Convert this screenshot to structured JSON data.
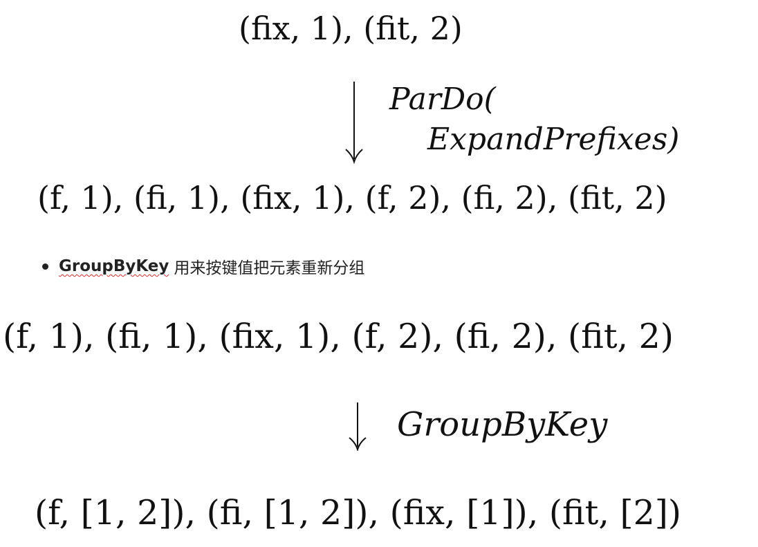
{
  "diagram1": {
    "input": "(fix, 1), (fit, 2)",
    "operation_line1": "ParDo(",
    "operation_line2": "ExpandPrefixes)",
    "output": "(f, 1), (fi, 1), (fix, 1), (f, 2), (fi, 2), (fit, 2)"
  },
  "bullet": {
    "term": "GroupByKey",
    "description": "用来按键值把元素重新分组"
  },
  "diagram2": {
    "input": "(f, 1), (fi, 1), (fix, 1), (f, 2), (fi, 2), (fit, 2)",
    "operation": "GroupByKey",
    "output": "(f, [1, 2]), (fi, [1, 2]), (fix, [1]), (fit, [2])"
  },
  "icons": {
    "arrow": "down-arrow-icon",
    "bullet": "bullet-dot-icon"
  }
}
